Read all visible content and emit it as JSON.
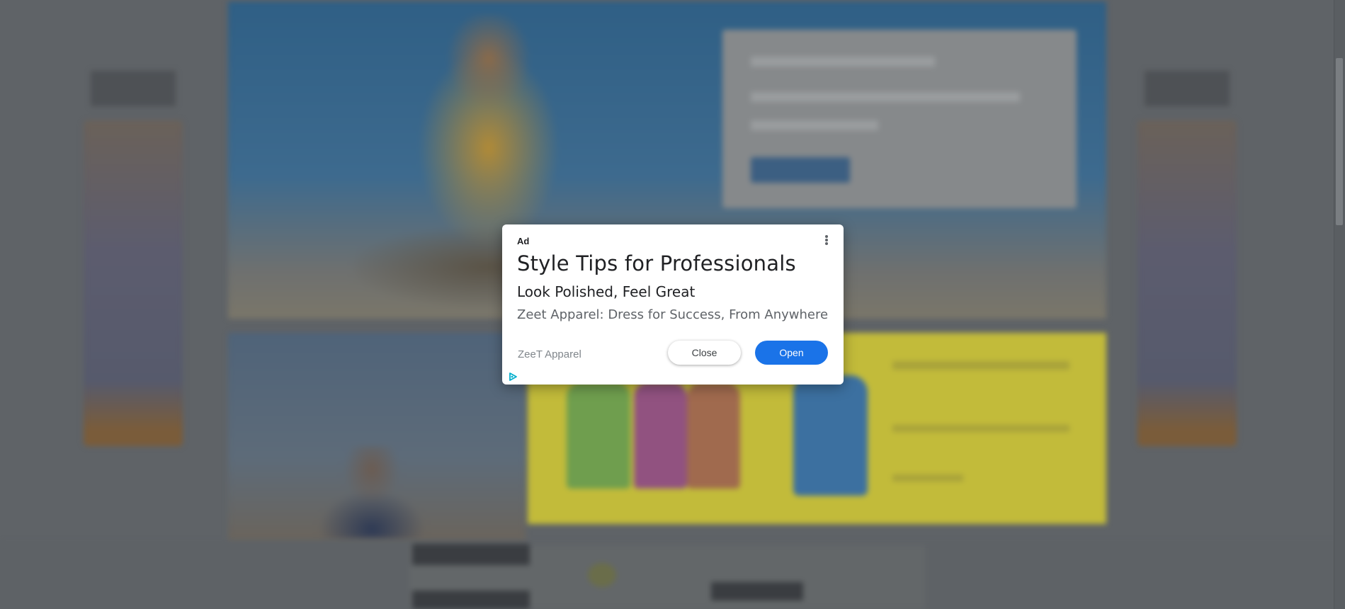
{
  "ad": {
    "label": "Ad",
    "title": "Style Tips for Professionals",
    "subtitle": "Look Polished, Feel Great",
    "description": "Zeet Apparel: Dress for Success, From Anywhere",
    "advertiser": "ZeeT Apparel",
    "close_label": "Close",
    "open_label": "Open",
    "accent_color": "#1a73e8"
  },
  "icons": {
    "menu": "more-vert-icon",
    "adchoices": "adchoices-play-icon"
  },
  "background": {
    "overlay": "dimmed",
    "overlay_color": "#5f6367"
  }
}
